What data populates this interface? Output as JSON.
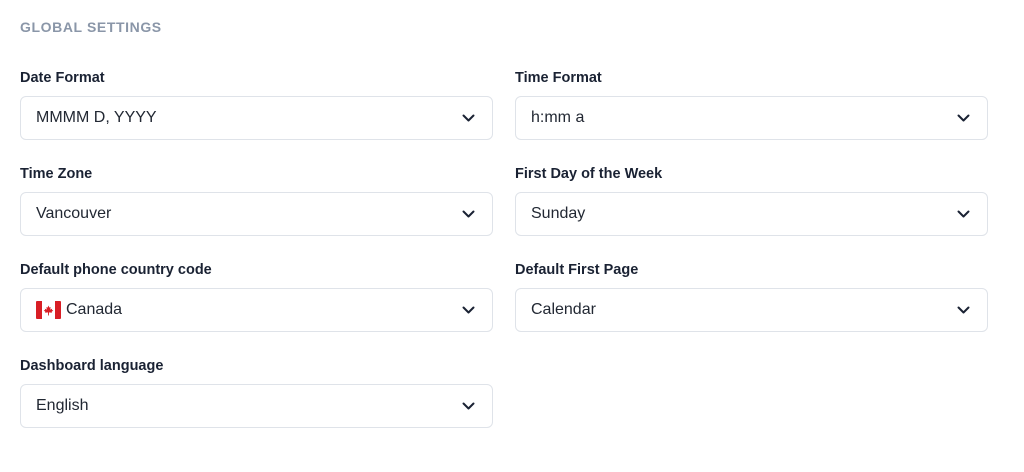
{
  "section": {
    "title": "GLOBAL SETTINGS"
  },
  "fields": {
    "date_format": {
      "label": "Date Format",
      "value": "MMMM D, YYYY"
    },
    "time_format": {
      "label": "Time Format",
      "value": "h:mm a"
    },
    "time_zone": {
      "label": "Time Zone",
      "value": "Vancouver"
    },
    "first_day": {
      "label": "First Day of the Week",
      "value": "Sunday"
    },
    "phone_code": {
      "label": "Default phone country code",
      "value": "Canada",
      "flag_icon": "canada-flag-icon"
    },
    "first_page": {
      "label": "Default First Page",
      "value": "Calendar"
    },
    "language": {
      "label": "Dashboard language",
      "value": "English"
    }
  },
  "icons": {
    "dropdown": "chevron-down-icon"
  },
  "colors": {
    "section_title": "#8a96a8",
    "label": "#1a2233",
    "border": "#dfe3e9",
    "flag_red": "#d81e25"
  }
}
